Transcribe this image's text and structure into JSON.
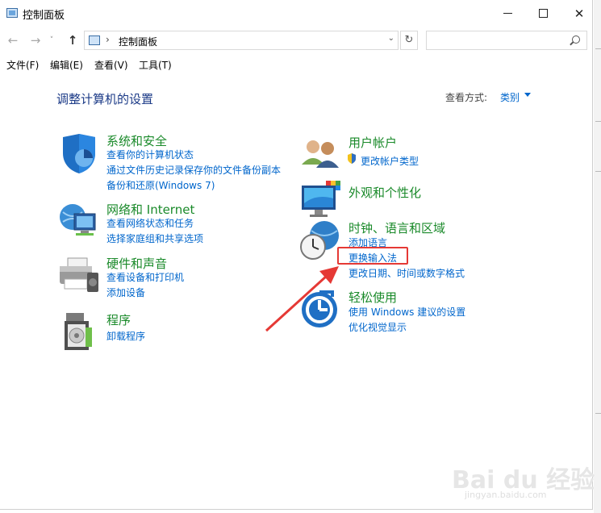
{
  "window": {
    "title": "控制面板",
    "minimize_glyph": "",
    "maximize_glyph": "",
    "close_glyph": "✕"
  },
  "nav": {
    "back_glyph": "←",
    "forward_glyph": "→",
    "recent_glyph": "˅",
    "up_glyph": "↑",
    "breadcrumb_sep": "›",
    "address": "控制面板",
    "dropdown_glyph": "⌄",
    "refresh_glyph": "↻",
    "search_placeholder": ""
  },
  "menu": [
    "文件(F)",
    "编辑(E)",
    "查看(V)",
    "工具(T)"
  ],
  "header": {
    "title": "调整计算机的设置",
    "view_label": "查看方式:",
    "view_value": "类别"
  },
  "categories": {
    "system": {
      "title": "系统和安全",
      "links": [
        "查看你的计算机状态",
        "通过文件历史记录保存你的文件备份副本",
        "备份和还原(Windows 7)"
      ]
    },
    "network": {
      "title": "网络和 Internet",
      "links": [
        "查看网络状态和任务",
        "选择家庭组和共享选项"
      ]
    },
    "hardware": {
      "title": "硬件和声音",
      "links": [
        "查看设备和打印机",
        "添加设备"
      ]
    },
    "programs": {
      "title": "程序",
      "links": [
        "卸载程序"
      ]
    },
    "user": {
      "title": "用户帐户",
      "links": [
        "更改帐户类型"
      ]
    },
    "appearance": {
      "title": "外观和个性化",
      "links": []
    },
    "clock": {
      "title": "时钟、语言和区域",
      "links": [
        "添加语言",
        "更换输入法",
        "更改日期、时间或数字格式"
      ]
    },
    "ease": {
      "title": "轻松使用",
      "links": [
        "使用 Windows 建议的设置",
        "优化视觉显示"
      ]
    }
  },
  "watermark": {
    "brand": "Bai du 经验",
    "url": "jingyan.baidu.com"
  },
  "colors": {
    "category_title": "#1a8a2a",
    "link": "#0066cc",
    "page_title": "#1b3a87",
    "annotation": "#e53935"
  }
}
